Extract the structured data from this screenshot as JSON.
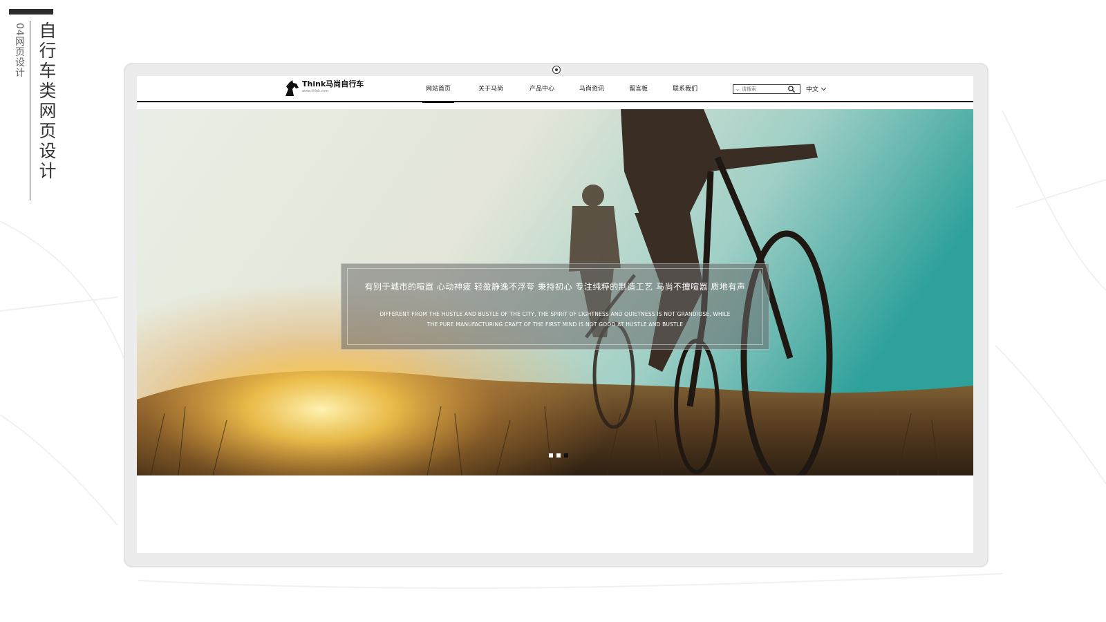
{
  "side": {
    "subtitle": "04网页设计",
    "title": "自行车类网页设计"
  },
  "site": {
    "logo_text": "Think马尚自行车",
    "logo_url": "www.think.com"
  },
  "nav": {
    "items": [
      {
        "label": "网站首页",
        "active": true
      },
      {
        "label": "关于马尚",
        "active": false
      },
      {
        "label": "产品中心",
        "active": false
      },
      {
        "label": "马尚资讯",
        "active": false
      },
      {
        "label": "留言板",
        "active": false
      },
      {
        "label": "联系我们",
        "active": false
      }
    ],
    "search_placeholder": "请搜索",
    "language": "中文"
  },
  "hero": {
    "caption_zh": "有别于城市的喧嚣 心动神疲 轻盈静逸不浮夸 秉持初心 专注纯粹的制造工艺 马尚不擅喧嚣 质地有声",
    "caption_en_line1": "DIFFERENT FROM THE HUSTLE AND BUSTLE OF THE CITY, THE SPIRIT OF LIGHTNESS AND QUIETNESS IS NOT GRANDIOSE, WHILE",
    "caption_en_line2": "THE PURE MANUFACTURING CRAFT OF THE FIRST MIND IS NOT GOOD AT HUSTLE AND BUSTLE",
    "slides": 3,
    "active_slide": 3
  },
  "colors": {
    "sky_top": "#d8ebe6",
    "sky_right": "#3aa8a2",
    "sun": "#f6c34a",
    "ground": "#3a2a18",
    "nav_active": "#111111"
  },
  "icons": [
    "horse-logo-icon",
    "search-icon",
    "chevron-down-icon",
    "camera-icon"
  ]
}
